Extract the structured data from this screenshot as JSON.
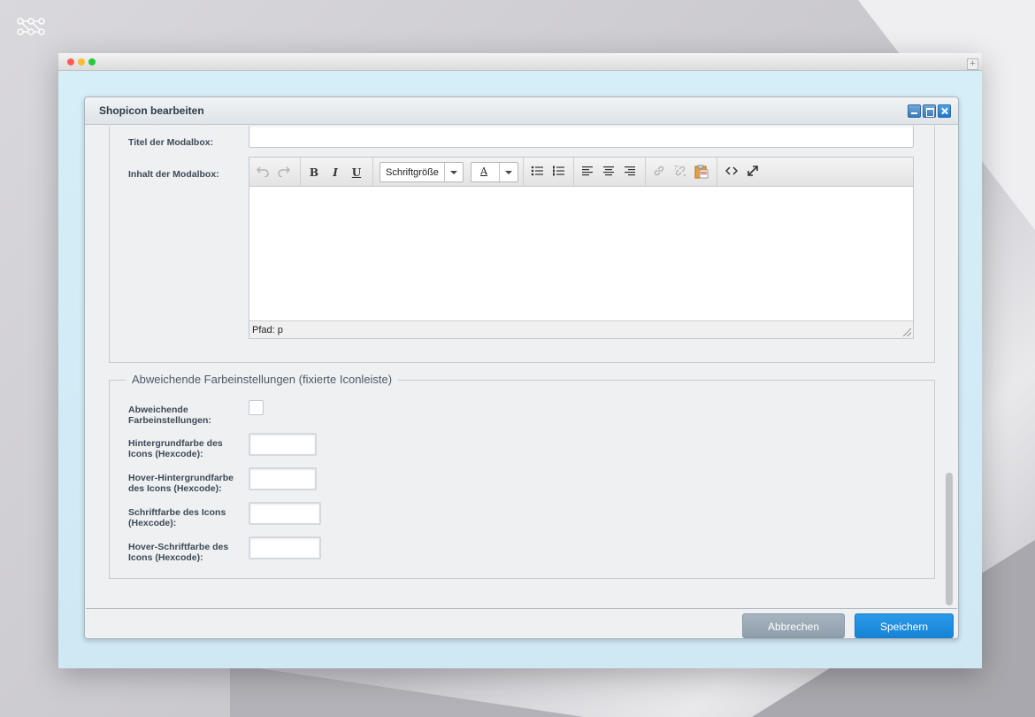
{
  "dialog": {
    "title": "Shopicon bearbeiten",
    "minimize_icon": "minimize-icon",
    "maximize_icon": "maximize-icon",
    "close_icon": "close-icon"
  },
  "modal": {
    "title_label": "Titel der Modalbox:",
    "title_value": "",
    "content_label": "Inhalt der Modalbox:"
  },
  "editor": {
    "toolbar": {
      "undo": "undo-icon",
      "redo": "redo-icon",
      "bold": "B",
      "italic": "I",
      "underline": "U",
      "font_size": "Schriftgröße",
      "font_color": "A",
      "bullet_list": "bullet-list-icon",
      "numbered_list": "numbered-list-icon",
      "align_left": "align-left-icon",
      "align_center": "align-center-icon",
      "align_right": "align-right-icon",
      "link": "link-icon",
      "unlink": "unlink-icon",
      "paste": "paste-icon",
      "source": "source-code-icon",
      "fullscreen": "fullscreen-icon"
    },
    "status_path": "Pfad: p"
  },
  "colors_section": {
    "legend": "Abweichende Farbeinstellungen (fixierte Iconleiste)",
    "custom_colors_label_1": "Abweichende",
    "custom_colors_label_2": "Farbeinstellungen:",
    "custom_colors_checked": false,
    "bg_color_label_1": "Hintergrundfarbe des",
    "bg_color_label_2": "Icons (Hexcode):",
    "hover_bg_label_1": "Hover-Hintergrundfarbe",
    "hover_bg_label_2": "des Icons (Hexcode):",
    "font_color_label_1": "Schriftfarbe des Icons",
    "font_color_label_2": "(Hexcode):",
    "hover_font_label_1": "Hover-Schriftfarbe des",
    "hover_font_label_2": "Icons (Hexcode):"
  },
  "footer": {
    "cancel": "Abbrechen",
    "save": "Speichern"
  },
  "colors": {
    "primary": "#1b88d9",
    "secondary": "#9aa8b6"
  }
}
